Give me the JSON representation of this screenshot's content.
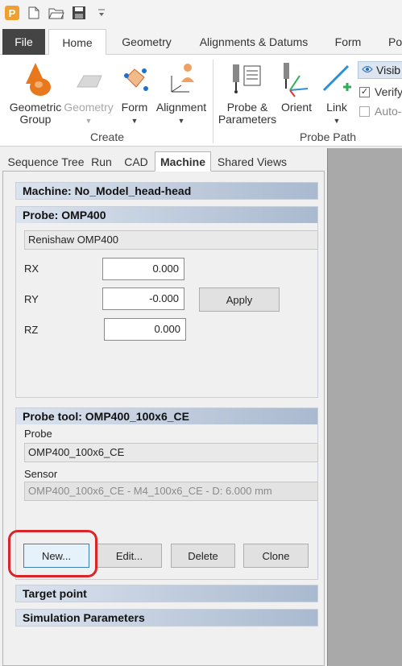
{
  "quick_access": {
    "icons": [
      "app-logo",
      "new-document-icon",
      "open-folder-icon",
      "save-icon",
      "customize-dropdown-icon"
    ],
    "app_logo_letter": "P"
  },
  "tabs": {
    "file": "File",
    "home": "Home",
    "geometry": "Geometry",
    "alignments": "Alignments & Datums",
    "form": "Form",
    "po": "Po"
  },
  "ribbon": {
    "geometric_group": "Geometric Group",
    "geometry": "Geometry",
    "form": "Form",
    "alignment": "Alignment",
    "create_group": "Create",
    "probe_parameters": "Probe & Parameters",
    "orient": "Orient",
    "link": "Link",
    "probe_path_group": "Probe Path",
    "visible": "Visib",
    "verify": "Verify",
    "auto": "Auto-"
  },
  "panel_tabs": {
    "sequence_tree": "Sequence Tree",
    "run": "Run",
    "cad": "CAD",
    "machine": "Machine",
    "shared_views": "Shared Views"
  },
  "machine": {
    "header": "Machine: No_Model_head-head"
  },
  "probe": {
    "header": "Probe: OMP400",
    "name": "Renishaw OMP400",
    "rx_label": "RX",
    "rx_value": "0.000",
    "ry_label": "RY",
    "ry_value": "-0.000",
    "rz_label": "RZ",
    "rz_value": "0.000",
    "apply": "Apply"
  },
  "probe_tool": {
    "header": "Probe tool: OMP400_100x6_CE",
    "probe_label": "Probe",
    "probe_value": "OMP400_100x6_CE",
    "sensor_label": "Sensor",
    "sensor_value": "OMP400_100x6_CE - M4_100x6_CE - D:  6.000 mm",
    "new": "New...",
    "edit": "Edit...",
    "delete": "Delete",
    "clone": "Clone"
  },
  "target_point": {
    "header": "Target point"
  },
  "simulation": {
    "header": "Simulation Parameters"
  },
  "colors": {
    "highlight": "#d9252a",
    "section_gradient_start": "#dbe3ee",
    "section_gradient_end": "#a9b9cf",
    "file_tab": "#444444"
  }
}
